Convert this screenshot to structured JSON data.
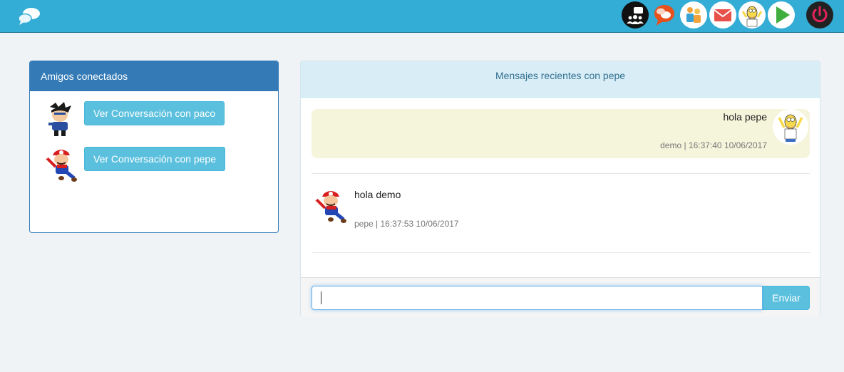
{
  "navbar": {
    "brand_icon": "chat-bubbles-icon",
    "icons": [
      {
        "name": "group-chat-icon",
        "bg": "#111111"
      },
      {
        "name": "messages-icon",
        "bg": "#ffffff"
      },
      {
        "name": "contacts-icon",
        "bg": "#ffffff"
      },
      {
        "name": "mail-icon",
        "bg": "#ffffff"
      },
      {
        "name": "user-avatar-icon",
        "bg": "#ffffff"
      },
      {
        "name": "play-icon",
        "bg": "#ffffff"
      },
      {
        "name": "power-icon",
        "bg": "#222222"
      }
    ],
    "colors": {
      "bar": "#33add6"
    }
  },
  "friends_panel": {
    "title": "Amigos conectados",
    "friends": [
      {
        "avatar": "ninja-avatar",
        "button_label": "Ver Conversación con paco"
      },
      {
        "avatar": "mario-avatar",
        "button_label": "Ver Conversación con pepe"
      }
    ]
  },
  "chat_panel": {
    "title": "Mensajes recientes con pepe",
    "messages": [
      {
        "text": "hola pepe",
        "meta": "demo | 16:37:40 10/06/2017",
        "avatar": "homer-avatar",
        "mine": true
      },
      {
        "text": "hola demo",
        "meta": "pepe | 16:37:53 10/06/2017",
        "avatar": "mario-avatar",
        "mine": false
      }
    ],
    "input": {
      "value": "",
      "placeholder": ""
    },
    "send_label": "Enviar"
  }
}
